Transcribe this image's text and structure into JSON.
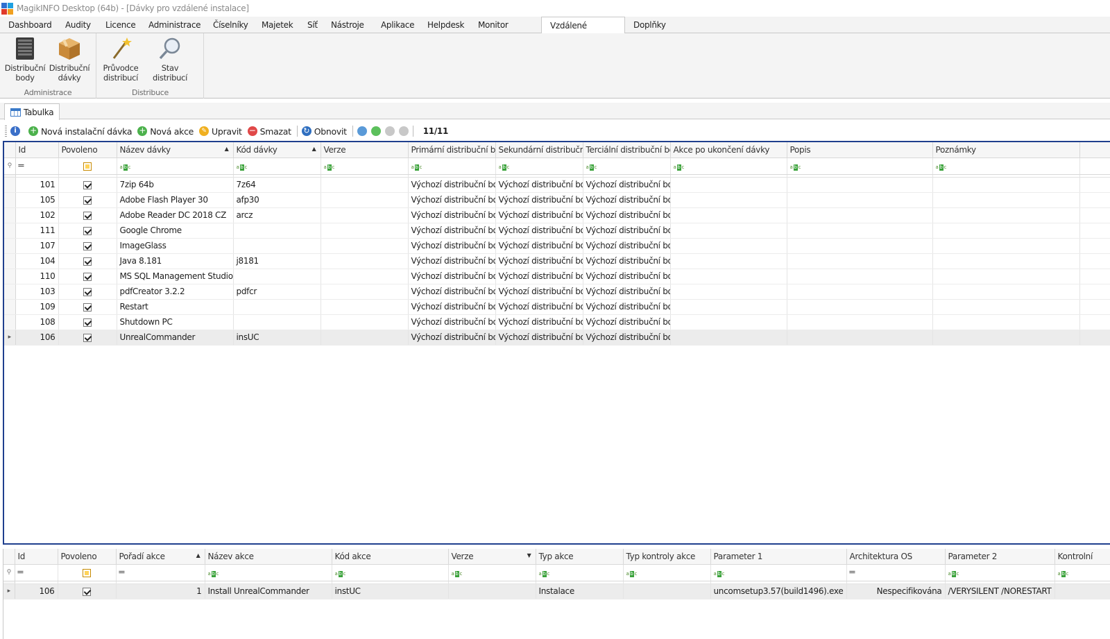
{
  "window": {
    "title": "MagikINFO Desktop (64b) - [Dávky pro vzdálené instalace]"
  },
  "menu": {
    "tabs": [
      {
        "label": "Dashboard",
        "width": 82
      },
      {
        "label": "Audity",
        "width": 58
      },
      {
        "label": "Licence",
        "width": 62
      },
      {
        "label": "Administrace",
        "width": 93
      },
      {
        "label": "Číselníky",
        "width": 70
      },
      {
        "label": "Majetek",
        "width": 66
      },
      {
        "label": "Síť",
        "width": 34
      },
      {
        "label": "Nástroje",
        "width": 72
      },
      {
        "label": "Aplikace",
        "width": 67
      },
      {
        "label": "Helpdesk",
        "width": 73
      },
      {
        "label": "Monitor aktivit",
        "width": 103
      },
      {
        "label": "Vzdálené distribuce",
        "width": 121,
        "active": true
      },
      {
        "label": "Doplňky",
        "width": 66
      }
    ]
  },
  "ribbon": {
    "groups": [
      {
        "label": "Administrace",
        "buttons": [
          "Distribuční body",
          "Distribuční dávky"
        ]
      },
      {
        "label": "Distribuce",
        "buttons": [
          "Průvodce distribucí",
          "Stav distribucí"
        ]
      }
    ]
  },
  "panel": {
    "tab_label": "Tabulka"
  },
  "toolbar": {
    "new_install_batch": "Nová instalační dávka",
    "new_action": "Nová akce",
    "edit": "Upravit",
    "delete": "Smazat",
    "refresh": "Obnovit",
    "count": "11/11"
  },
  "batches": {
    "columns": [
      "Id",
      "Povoleno",
      "Název dávky",
      "Kód dávky",
      "Verze",
      "Primární distribuční bod",
      "Sekundární distribučn...",
      "Terciální distribuční bod",
      "Akce po ukončení dávky",
      "Popis",
      "Poznámky"
    ],
    "rows": [
      {
        "id": "101",
        "name": "7zip 64b",
        "code": "7z64",
        "version": "",
        "primary": "Výchozí distribuční bod",
        "secondary": "Výchozí distribuční bod",
        "tertiary": "Výchozí distribuční bod"
      },
      {
        "id": "105",
        "name": "Adobe Flash Player 30",
        "code": "afp30",
        "version": "",
        "primary": "Výchozí distribuční bod",
        "secondary": "Výchozí distribuční bod",
        "tertiary": "Výchozí distribuční bod"
      },
      {
        "id": "102",
        "name": "Adobe Reader DC 2018 CZ",
        "code": "arcz",
        "version": "",
        "primary": "Výchozí distribuční bod",
        "secondary": "Výchozí distribuční bod",
        "tertiary": "Výchozí distribuční bod"
      },
      {
        "id": "111",
        "name": "Google Chrome",
        "code": "",
        "version": "",
        "primary": "Výchozí distribuční bod",
        "secondary": "Výchozí distribuční bod",
        "tertiary": "Výchozí distribuční bod"
      },
      {
        "id": "107",
        "name": "ImageGlass",
        "code": "",
        "version": "",
        "primary": "Výchozí distribuční bod",
        "secondary": "Výchozí distribuční bod",
        "tertiary": "Výchozí distribuční bod"
      },
      {
        "id": "104",
        "name": "Java 8.181",
        "code": "j8181",
        "version": "",
        "primary": "Výchozí distribuční bod",
        "secondary": "Výchozí distribuční bod",
        "tertiary": "Výchozí distribuční bod"
      },
      {
        "id": "110",
        "name": "MS SQL Management Studio",
        "code": "",
        "version": "",
        "primary": "Výchozí distribuční bod",
        "secondary": "Výchozí distribuční bod",
        "tertiary": "Výchozí distribuční bod"
      },
      {
        "id": "103",
        "name": "pdfCreator 3.2.2",
        "code": "pdfcr",
        "version": "",
        "primary": "Výchozí distribuční bod",
        "secondary": "Výchozí distribuční bod",
        "tertiary": "Výchozí distribuční bod"
      },
      {
        "id": "109",
        "name": "Restart",
        "code": "",
        "version": "",
        "primary": "Výchozí distribuční bod",
        "secondary": "Výchozí distribuční bod",
        "tertiary": "Výchozí distribuční bod"
      },
      {
        "id": "108",
        "name": "Shutdown PC",
        "code": "",
        "version": "",
        "primary": "Výchozí distribuční bod",
        "secondary": "Výchozí distribuční bod",
        "tertiary": "Výchozí distribuční bod"
      },
      {
        "id": "106",
        "name": "UnrealCommander",
        "code": "insUC",
        "version": "",
        "primary": "Výchozí distribuční bod",
        "secondary": "Výchozí distribuční bod",
        "tertiary": "Výchozí distribuční bod",
        "selected": true
      }
    ]
  },
  "actions": {
    "columns": [
      "Id",
      "Povoleno",
      "Pořadí akce",
      "Název akce",
      "Kód akce",
      "Verze",
      "Typ akce",
      "Typ kontroly akce",
      "Parameter 1",
      "Architektura OS",
      "Parameter 2",
      "Kontrolní"
    ],
    "rows": [
      {
        "id": "106",
        "order": "1",
        "name": "Install UnrealCommander",
        "code": "instUC",
        "version": "",
        "type": "Instalace",
        "check_type": "",
        "param1": "uncomsetup3.57(build1496).exe",
        "arch": "Nespecifikována",
        "param2": "/VERYSILENT /NORESTART",
        "control": ""
      }
    ]
  }
}
